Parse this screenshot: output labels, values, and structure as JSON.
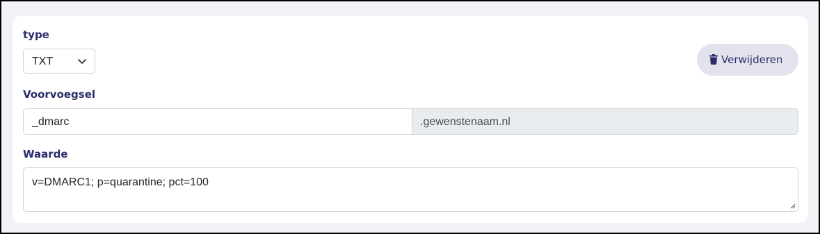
{
  "type_field": {
    "label": "type",
    "selected": "TXT"
  },
  "delete_button": {
    "label": "Verwijderen",
    "icon": "trash-icon"
  },
  "prefix_field": {
    "label": "Voorvoegsel",
    "value": "_dmarc",
    "suffix": ".gewenstenaam.nl"
  },
  "value_field": {
    "label": "Waarde",
    "value": "v=DMARC1; p=quarantine; pct=100"
  },
  "colors": {
    "label_text": "#2b2d6b",
    "button_bg": "#e3e3ee",
    "card_bg": "#ffffff",
    "page_bg": "#f1f2f5",
    "addon_bg": "#e9ecef"
  }
}
